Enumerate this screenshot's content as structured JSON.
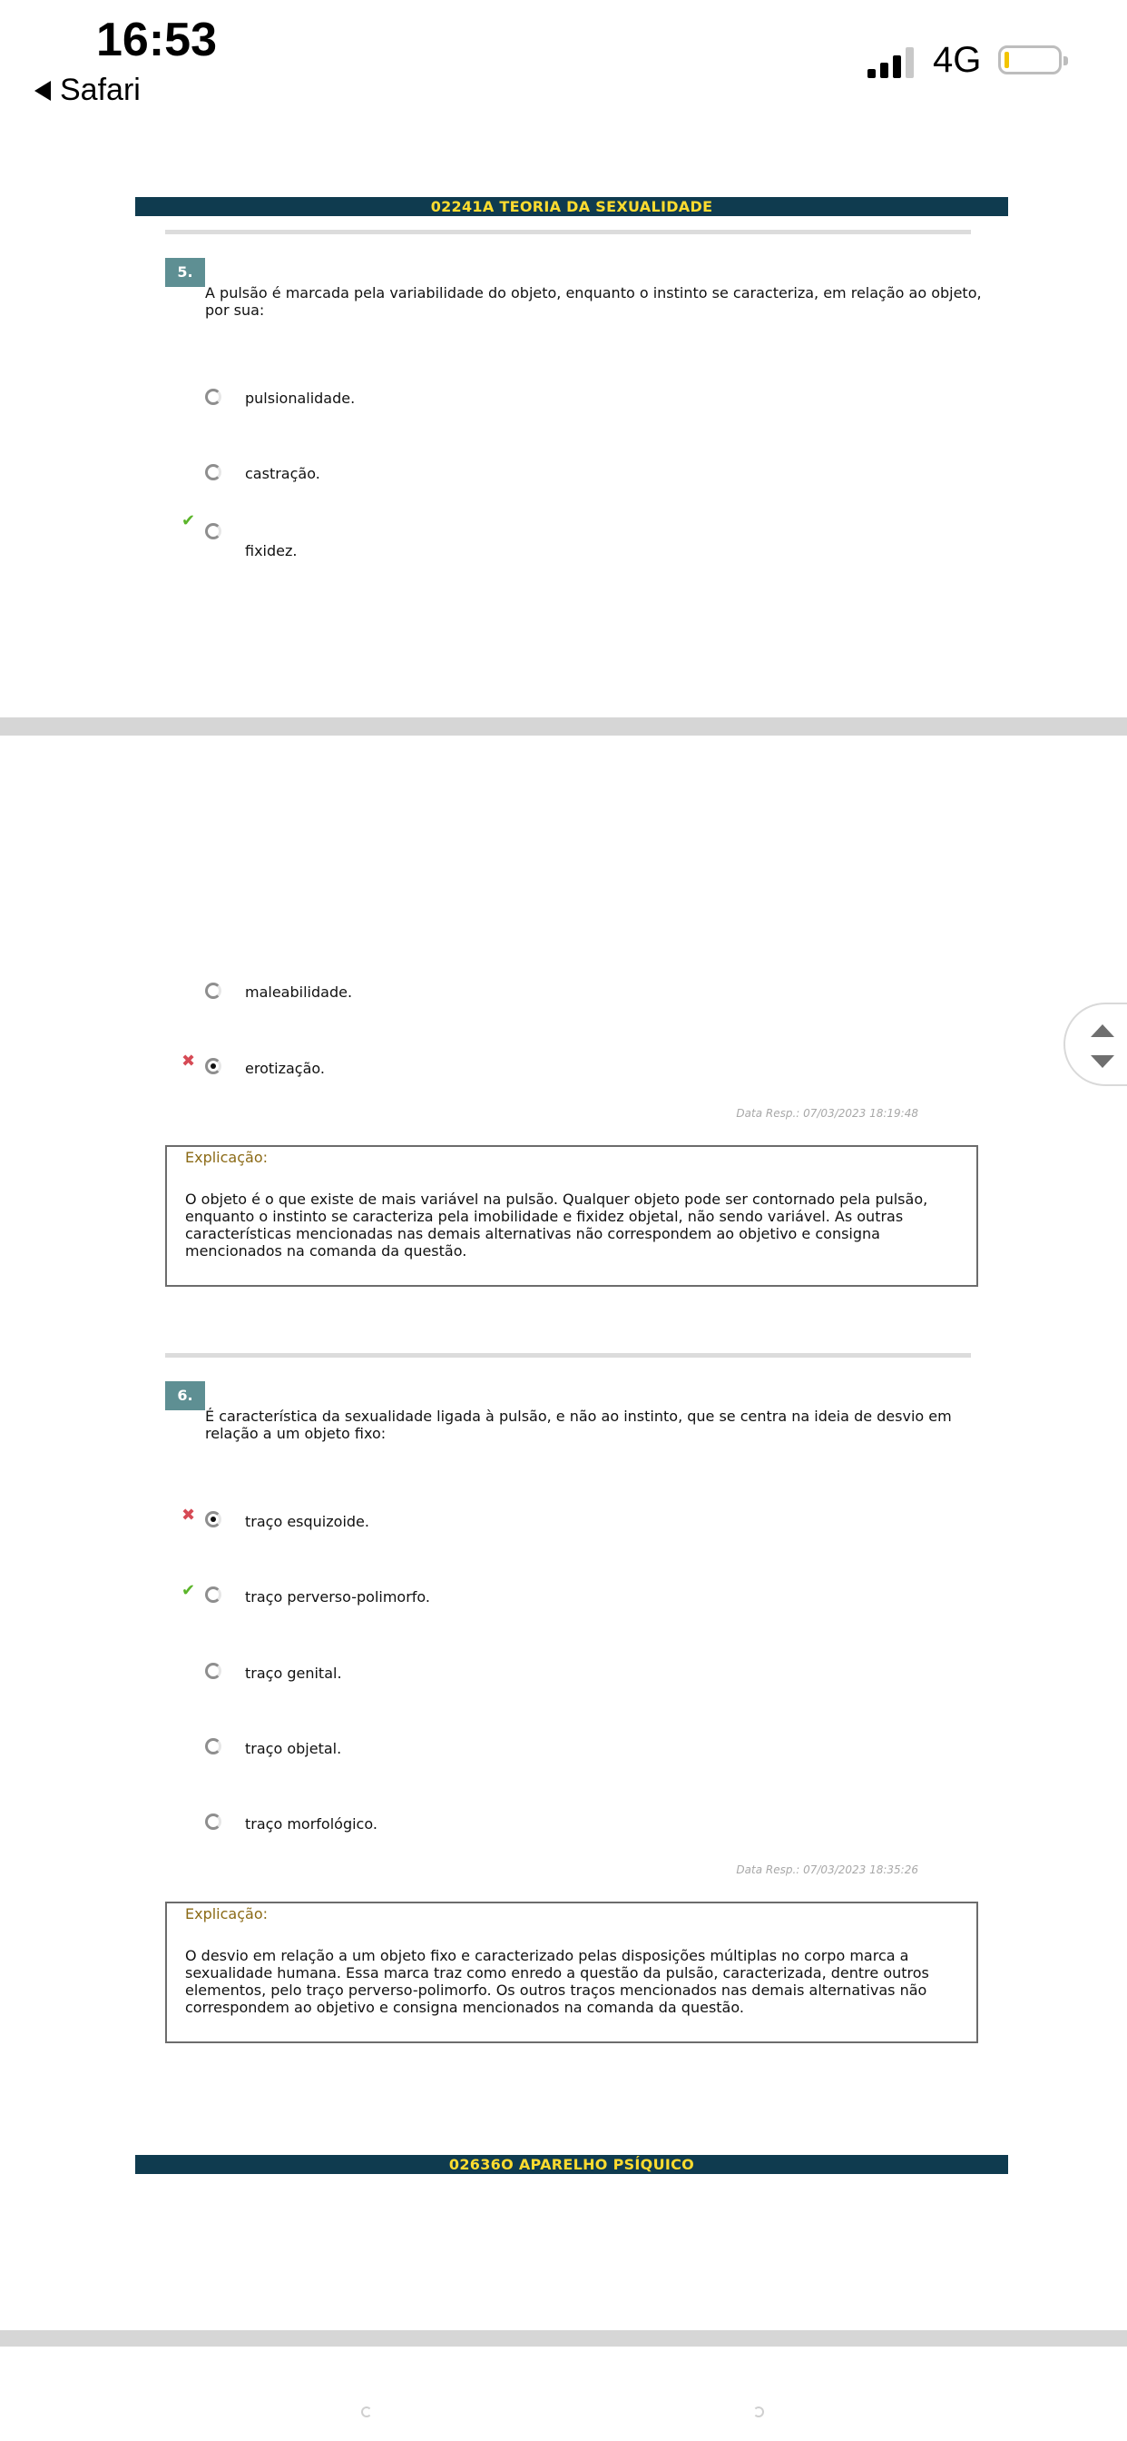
{
  "status_bar": {
    "time": "16:53",
    "back_label": "Safari",
    "network": "4G",
    "battery_level": 0.1
  },
  "course_banner": "02241A TEORIA DA SEXUALIDADE",
  "questions": [
    {
      "number": "5.",
      "text": "A pulsão é marcada pela variabilidade do objeto, enquanto o instinto se caracteriza, em relação ao objeto, por sua:",
      "options": [
        {
          "label": "pulsionalidade.",
          "selected": false,
          "mark": ""
        },
        {
          "label": "castração.",
          "selected": false,
          "mark": ""
        },
        {
          "label": "fixidez.",
          "selected": false,
          "mark": "correct"
        },
        {
          "label": "maleabilidade.",
          "selected": false,
          "mark": ""
        },
        {
          "label": "erotização.",
          "selected": true,
          "mark": "wrong"
        }
      ],
      "date": "Data Resp.: 07/03/2023 18:19:48",
      "explanation_title": "Explicação:",
      "explanation": "O objeto é o que existe de mais variável na pulsão. Qualquer objeto pode ser contornado pela pulsão, enquanto o instinto se caracteriza pela imobilidade e fixidez objetal, não sendo variável. As outras características mencionadas nas demais alternativas não correspondem ao objetivo e consigna mencionados na comanda da questão."
    },
    {
      "number": "6.",
      "text": "É característica da sexualidade ligada à pulsão, e não ao instinto, que se centra na ideia de desvio em relação a um objeto fixo:",
      "options": [
        {
          "label": "traço esquizoide.",
          "selected": true,
          "mark": "wrong"
        },
        {
          "label": "traço perverso-polimorfo.",
          "selected": false,
          "mark": "correct"
        },
        {
          "label": "traço genital.",
          "selected": false,
          "mark": ""
        },
        {
          "label": "traço objetal.",
          "selected": false,
          "mark": ""
        },
        {
          "label": "traço morfológico.",
          "selected": false,
          "mark": ""
        }
      ],
      "date": "Data Resp.: 07/03/2023 18:35:26",
      "explanation_title": "Explicação:",
      "explanation": "O desvio em relação a um objeto fixo e caracterizado pelas disposições múltiplas no corpo marca a sexualidade humana. Essa marca traz como enredo a questão da pulsão, caracterizada, dentre outros elementos, pelo traço perverso-polimorfo. Os outros traços mencionados nas demais alternativas não correspondem ao objetivo e consigna mencionados na comanda da questão."
    }
  ],
  "next_banner": "02636O APARELHO PSÍQUICO",
  "icons": {
    "correct": "check-mark-icon",
    "wrong": "x-mark-icon",
    "colors": {
      "banner_bg": "#0f3b4f",
      "banner_text": "#ffdc2f",
      "qnum_bg": "#5e8f93",
      "correct": "#5bb52a",
      "wrong": "#d64a55"
    }
  }
}
